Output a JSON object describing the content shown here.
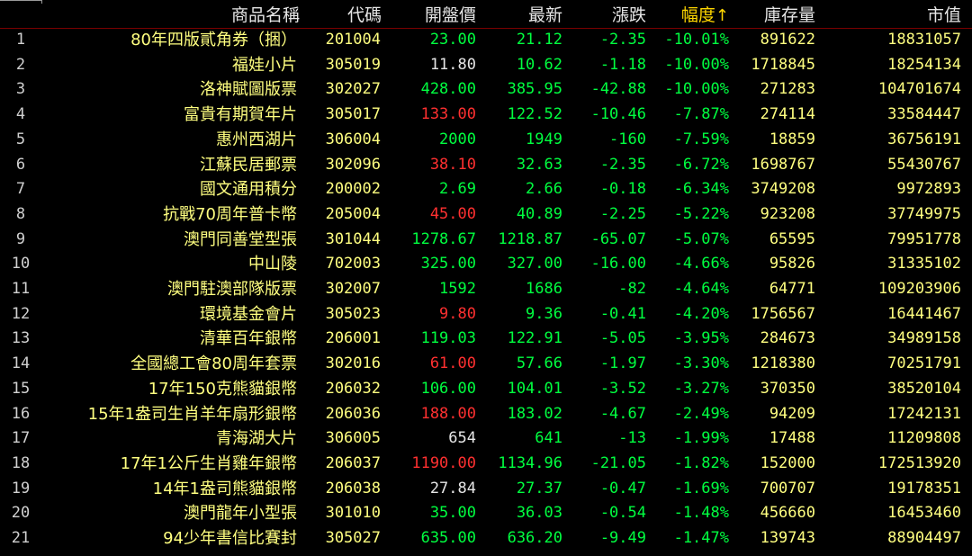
{
  "columns": {
    "name": "商品名稱",
    "code": "代碼",
    "open": "開盤價",
    "last": "最新",
    "change": "漲跌",
    "pct": "幅度",
    "pct_sort_arrow": "↑",
    "stock": "庫存量",
    "market_value": "市值"
  },
  "colors": {
    "background": "#000000",
    "header_text": "#e6e6e6",
    "sorted_header": "#ffd700",
    "name_text": "#ffff80",
    "rise": "#ff3030",
    "fall": "#00ff40",
    "flat": "#e6e6e6",
    "header_separator": "#7a0000"
  },
  "rows": [
    {
      "idx": "1",
      "name": "80年四版貳角券（捆）",
      "code": "201004",
      "open": "23.00",
      "open_dir": "down",
      "last": "21.12",
      "last_dir": "down",
      "change": "-2.35",
      "pct": "-10.01%",
      "stock": "891622",
      "market_value": "18831057"
    },
    {
      "idx": "2",
      "name": "福娃小片",
      "code": "305019",
      "open": "11.80",
      "open_dir": "flat",
      "last": "10.62",
      "last_dir": "down",
      "change": "-1.18",
      "pct": "-10.00%",
      "stock": "1718845",
      "market_value": "18254134"
    },
    {
      "idx": "3",
      "name": "洛神賦圖版票",
      "code": "302027",
      "open": "428.00",
      "open_dir": "down",
      "last": "385.95",
      "last_dir": "down",
      "change": "-42.88",
      "pct": "-10.00%",
      "stock": "271283",
      "market_value": "104701674"
    },
    {
      "idx": "4",
      "name": "富貴有期賀年片",
      "code": "305017",
      "open": "133.00",
      "open_dir": "up",
      "last": "122.52",
      "last_dir": "down",
      "change": "-10.46",
      "pct": "-7.87%",
      "stock": "274114",
      "market_value": "33584447"
    },
    {
      "idx": "5",
      "name": "惠州西湖片",
      "code": "306004",
      "open": "2000",
      "open_dir": "down",
      "last": "1949",
      "last_dir": "down",
      "change": "-160",
      "pct": "-7.59%",
      "stock": "18859",
      "market_value": "36756191"
    },
    {
      "idx": "6",
      "name": "江蘇民居郵票",
      "code": "302096",
      "open": "38.10",
      "open_dir": "up",
      "last": "32.63",
      "last_dir": "down",
      "change": "-2.35",
      "pct": "-6.72%",
      "stock": "1698767",
      "market_value": "55430767"
    },
    {
      "idx": "7",
      "name": "國文通用積分",
      "code": "200002",
      "open": "2.69",
      "open_dir": "down",
      "last": "2.66",
      "last_dir": "down",
      "change": "-0.18",
      "pct": "-6.34%",
      "stock": "3749208",
      "market_value": "9972893"
    },
    {
      "idx": "8",
      "name": "抗戰70周年普卡幣",
      "code": "205004",
      "open": "45.00",
      "open_dir": "up",
      "last": "40.89",
      "last_dir": "down",
      "change": "-2.25",
      "pct": "-5.22%",
      "stock": "923208",
      "market_value": "37749975"
    },
    {
      "idx": "9",
      "name": "澳門同善堂型張",
      "code": "301044",
      "open": "1278.67",
      "open_dir": "down",
      "last": "1218.87",
      "last_dir": "down",
      "change": "-65.07",
      "pct": "-5.07%",
      "stock": "65595",
      "market_value": "79951778"
    },
    {
      "idx": "10",
      "name": "中山陵",
      "code": "702003",
      "open": "325.00",
      "open_dir": "down",
      "last": "327.00",
      "last_dir": "down",
      "change": "-16.00",
      "pct": "-4.66%",
      "stock": "95826",
      "market_value": "31335102"
    },
    {
      "idx": "11",
      "name": "澳門駐澳部隊版票",
      "code": "302007",
      "open": "1592",
      "open_dir": "down",
      "last": "1686",
      "last_dir": "down",
      "change": "-82",
      "pct": "-4.64%",
      "stock": "64771",
      "market_value": "109203906"
    },
    {
      "idx": "12",
      "name": "環境基金會片",
      "code": "305023",
      "open": "9.80",
      "open_dir": "up",
      "last": "9.36",
      "last_dir": "down",
      "change": "-0.41",
      "pct": "-4.20%",
      "stock": "1756567",
      "market_value": "16441467"
    },
    {
      "idx": "13",
      "name": "清華百年銀幣",
      "code": "206001",
      "open": "119.03",
      "open_dir": "down",
      "last": "122.91",
      "last_dir": "down",
      "change": "-5.05",
      "pct": "-3.95%",
      "stock": "284673",
      "market_value": "34989158"
    },
    {
      "idx": "14",
      "name": "全國總工會80周年套票",
      "code": "302016",
      "open": "61.00",
      "open_dir": "up",
      "last": "57.66",
      "last_dir": "down",
      "change": "-1.97",
      "pct": "-3.30%",
      "stock": "1218380",
      "market_value": "70251791"
    },
    {
      "idx": "15",
      "name": "17年150克熊貓銀幣",
      "code": "206032",
      "open": "106.00",
      "open_dir": "down",
      "last": "104.01",
      "last_dir": "down",
      "change": "-3.52",
      "pct": "-3.27%",
      "stock": "370350",
      "market_value": "38520104"
    },
    {
      "idx": "16",
      "name": "15年1盎司生肖羊年扇形銀幣",
      "code": "206036",
      "open": "188.00",
      "open_dir": "up",
      "last": "183.02",
      "last_dir": "down",
      "change": "-4.67",
      "pct": "-2.49%",
      "stock": "94209",
      "market_value": "17242131"
    },
    {
      "idx": "17",
      "name": "青海湖大片",
      "code": "306005",
      "open": "654",
      "open_dir": "flat",
      "last": "641",
      "last_dir": "down",
      "change": "-13",
      "pct": "-1.99%",
      "stock": "17488",
      "market_value": "11209808"
    },
    {
      "idx": "18",
      "name": "17年1公斤生肖雞年銀幣",
      "code": "206037",
      "open": "1190.00",
      "open_dir": "up",
      "last": "1134.96",
      "last_dir": "down",
      "change": "-21.05",
      "pct": "-1.82%",
      "stock": "152000",
      "market_value": "172513920"
    },
    {
      "idx": "19",
      "name": "14年1盎司熊貓銀幣",
      "code": "206038",
      "open": "27.84",
      "open_dir": "flat",
      "last": "27.37",
      "last_dir": "down",
      "change": "-0.47",
      "pct": "-1.69%",
      "stock": "700707",
      "market_value": "19178351"
    },
    {
      "idx": "20",
      "name": "澳門龍年小型張",
      "code": "301010",
      "open": "35.00",
      "open_dir": "down",
      "last": "36.03",
      "last_dir": "down",
      "change": "-0.54",
      "pct": "-1.48%",
      "stock": "456660",
      "market_value": "16453460"
    },
    {
      "idx": "21",
      "name": "94少年書信比賽封",
      "code": "305027",
      "open": "635.00",
      "open_dir": "down",
      "last": "636.20",
      "last_dir": "down",
      "change": "-9.49",
      "pct": "-1.47%",
      "stock": "139743",
      "market_value": "88904497"
    }
  ]
}
